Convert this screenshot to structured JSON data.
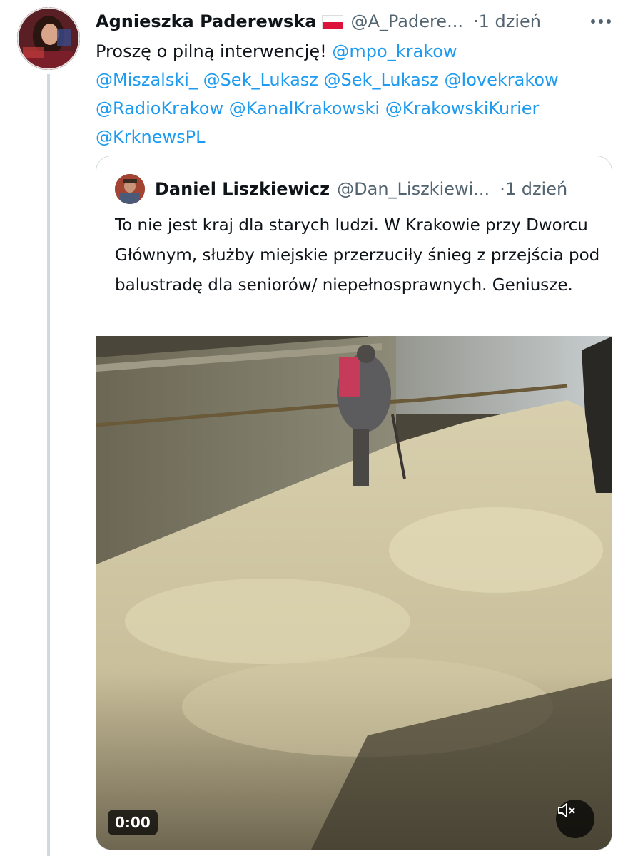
{
  "post": {
    "display_name": "Agnieszka Paderewska",
    "handle": "@A_Padere...",
    "separator": "·",
    "time": "1 dzień",
    "text_intro": "Proszę o pilną interwencję!",
    "mentions": [
      "@mpo_krakow",
      "@Miszalski_",
      "@Sek_Lukasz",
      "@Sek_Lukasz",
      "@lovekrakow",
      "@RadioKrakow",
      "@KanalKrakowski",
      "@KrakowskiKurier",
      "@KrknewsPL"
    ]
  },
  "quoted": {
    "display_name": "Daniel Liszkiewicz",
    "handle": "@Dan_Liszkiewi...",
    "separator": "·",
    "time": "1 dzień",
    "text": "To nie jest kraj dla starych ludzi. W Krakowie przy Dworcu Głównym, służby miejskie przerzuciły śnieg z przejścia pod balustradę dla seniorów/ niepełnosprawnych. Geniusze.",
    "video": {
      "timestamp": "0:00",
      "muted": true
    }
  },
  "icons": {
    "more": "more-horizontal-icon",
    "mute": "volume-muted-icon",
    "flag": "poland-flag-icon"
  },
  "colors": {
    "mention": "#1d9bf0",
    "secondary_text": "#536471",
    "border": "#cfd9de"
  }
}
